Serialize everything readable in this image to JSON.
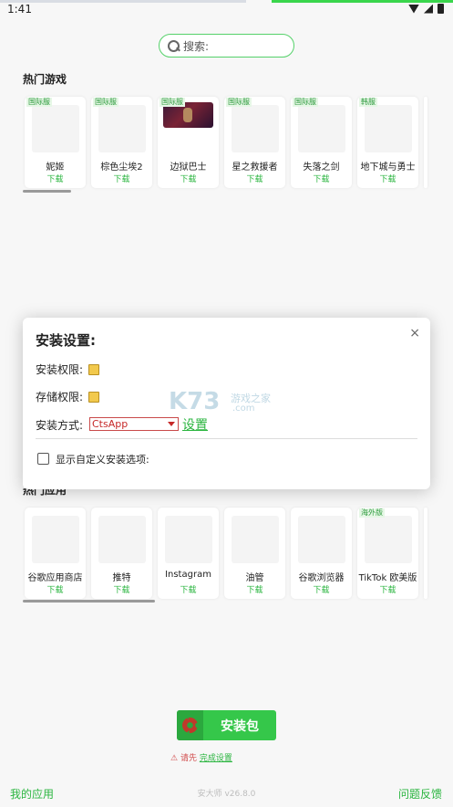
{
  "status_bar": {
    "time": "1:41"
  },
  "search": {
    "placeholder": "搜索:"
  },
  "hot_games": {
    "title": "热门游戏",
    "items": [
      {
        "badge": "国际服",
        "name": "妮姬",
        "action": "下载"
      },
      {
        "badge": "国际服",
        "name": "棕色尘埃2",
        "action": "下载"
      },
      {
        "badge": "国际服",
        "name": "边狱巴士",
        "action": "下载"
      },
      {
        "badge": "国际服",
        "name": "星之救援者",
        "action": "下载"
      },
      {
        "badge": "国际服",
        "name": "失落之剑",
        "action": "下载"
      },
      {
        "badge": "韩服",
        "name": "地下城与勇士",
        "action": "下载"
      }
    ]
  },
  "hot_apps": {
    "title": "热门应用",
    "items": [
      {
        "badge": "",
        "name": "谷歌应用商店",
        "action": "下载"
      },
      {
        "badge": "",
        "name": "推特",
        "action": "下载"
      },
      {
        "badge": "",
        "name": "Instagram",
        "action": "下载"
      },
      {
        "badge": "",
        "name": "油管",
        "action": "下载"
      },
      {
        "badge": "",
        "name": "谷歌浏览器",
        "action": "下载"
      },
      {
        "badge": "海外版",
        "name": "TikTok 欧美版",
        "action": "下载"
      }
    ]
  },
  "dialog": {
    "title": "安装设置:",
    "close": "×",
    "install_permission": "安装权限:",
    "storage_permission": "存储权限:",
    "install_method_label": "安装方式:",
    "install_method_value": "CtsApp",
    "settings_link": "设置",
    "custom_options_label": "显示自定义安装选项:"
  },
  "watermark": {
    "logo": "K73",
    "text": "游戏之家",
    "domain": ".com"
  },
  "install_button": {
    "label": "安装包"
  },
  "warning": {
    "icon": "⚠",
    "prefix": "请先",
    "link": "完成设置"
  },
  "footer": {
    "my_apps": "我的应用",
    "version": "安大师 v26.8.0",
    "feedback": "问题反馈"
  },
  "colors": {
    "accent": "#2ab53f",
    "button": "#35c74a",
    "warning": "#d14b4b"
  }
}
